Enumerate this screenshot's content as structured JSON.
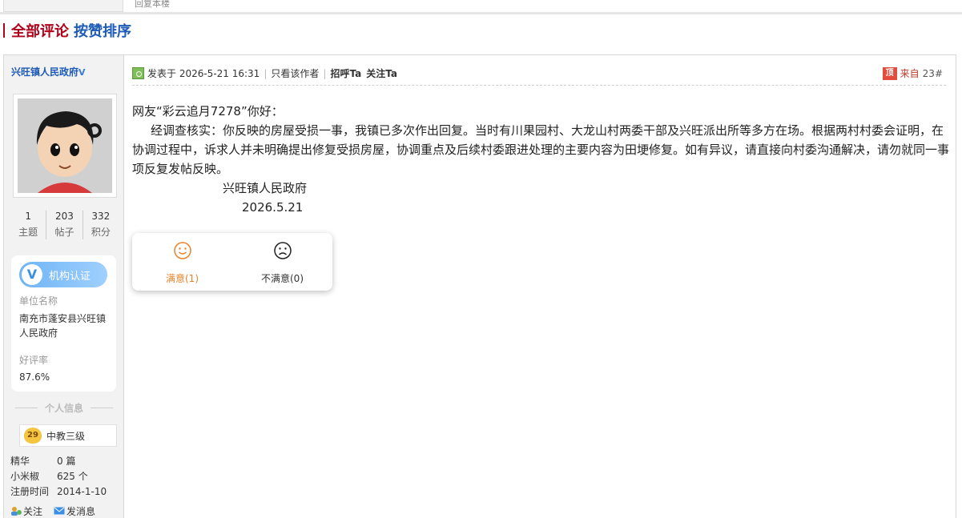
{
  "top": {
    "reply_hint": "回复本楼"
  },
  "section": {
    "all_comments": "全部评论",
    "sort_by_likes": "按赞排序"
  },
  "user": {
    "name": "兴旺镇人民政府",
    "verified_mark": "V",
    "stats": [
      {
        "num": "1",
        "label": "主题"
      },
      {
        "num": "203",
        "label": "帖子"
      },
      {
        "num": "332",
        "label": "积分"
      }
    ],
    "cert_label": "机构认证",
    "unit_key": "单位名称",
    "unit_value": "南充市蓬安县兴旺镇人民政府",
    "rating_key": "好评率",
    "rating_value": "87.6%",
    "personal_info": "个人信息",
    "level_num": "29",
    "level_name": "中教三级",
    "info": [
      {
        "k": "精华",
        "v": "0 篇"
      },
      {
        "k": "小米椒",
        "v": "625 个"
      },
      {
        "k": "注册时间",
        "v": "2014-1-10"
      }
    ],
    "follow": "关注",
    "message": "发消息"
  },
  "post": {
    "posted_at": "发表于 2026-5-21 16:31",
    "only_author": "只看该作者",
    "greet": "招呼Ta",
    "follow": "关注Ta",
    "top_icon": "顶",
    "from": "来自",
    "floor": "23#",
    "greeting": "网友“彩云追月7278”你好：",
    "paragraph": "经调查核实：你反映的房屋受损一事，我镇已多次作出回复。当时有川果园村、大龙山村两委干部及兴旺派出所等多方在场。根据两村村委会证明，在协调过程中，诉求人并未明确提出修复受损房屋，协调重点及后续村委跟进处理的主要内容为田埂修复。如有异议，请直接向村委沟通解决，请勿就同一事项反复发帖反映。",
    "signature": "兴旺镇人民政府",
    "date": "2026.5.21",
    "satisfied": "满意(1)",
    "unsatisfied": "不满意(0)"
  }
}
